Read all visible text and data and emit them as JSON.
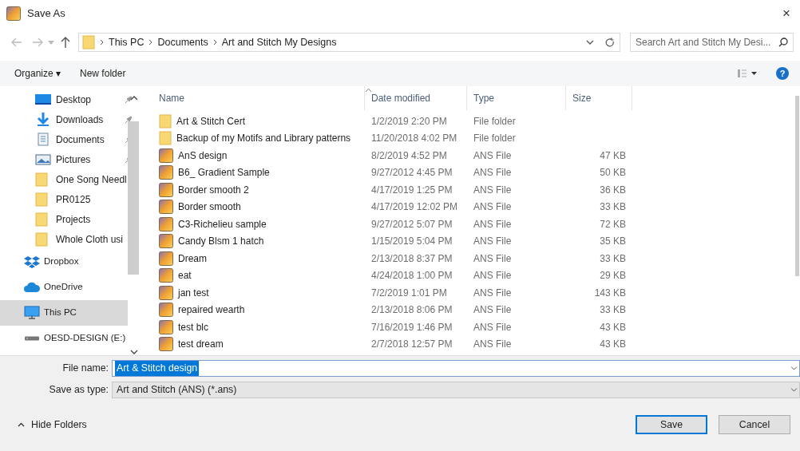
{
  "window": {
    "title": "Save As",
    "close": "×"
  },
  "address": {
    "path": [
      "This PC",
      "Documents",
      "Art and Stitch My Designs"
    ],
    "search_placeholder": "Search Art and Stitch My Desi..."
  },
  "toolbar": {
    "organize": "Organize ▾",
    "new_folder": "New folder",
    "help": "?"
  },
  "sidebar": {
    "quick_access_items": [
      {
        "kind": "desktop",
        "label": "Desktop",
        "pinned": true
      },
      {
        "kind": "downloads",
        "label": "Downloads",
        "pinned": true
      },
      {
        "kind": "documents",
        "label": "Documents",
        "pinned": true
      },
      {
        "kind": "pictures",
        "label": "Pictures",
        "pinned": true
      },
      {
        "kind": "folder",
        "label": "One Song Needl",
        "pinned": false
      },
      {
        "kind": "folder",
        "label": "PR0125",
        "pinned": false
      },
      {
        "kind": "folder",
        "label": "Projects",
        "pinned": false
      },
      {
        "kind": "folder",
        "label": "Whole Cloth usi",
        "pinned": false
      }
    ],
    "locations": [
      {
        "kind": "dropbox",
        "label": "Dropbox",
        "selected": false
      },
      {
        "kind": "onedrive",
        "label": "OneDrive",
        "selected": false
      },
      {
        "kind": "pc",
        "label": "This PC",
        "selected": true
      },
      {
        "kind": "drive",
        "label": "OESD-DESIGN (E:)",
        "selected": false
      }
    ]
  },
  "table": {
    "columns": [
      "Name",
      "Date modified",
      "Type",
      "Size"
    ],
    "rows": [
      {
        "kind": "folder",
        "name": "Art & Stitch Cert",
        "date": "1/2/2019 2:20 PM",
        "type": "File folder",
        "size": ""
      },
      {
        "kind": "folder",
        "name": "Backup of my Motifs and Library patterns",
        "date": "11/20/2018 4:02 PM",
        "type": "File folder",
        "size": ""
      },
      {
        "kind": "ans",
        "name": "AnS design",
        "date": "8/2/2019 4:52 PM",
        "type": "ANS File",
        "size": "47 KB"
      },
      {
        "kind": "ans",
        "name": "B6_ Gradient Sample",
        "date": "9/27/2012 4:45 PM",
        "type": "ANS File",
        "size": "50 KB"
      },
      {
        "kind": "ans",
        "name": "Border smooth 2",
        "date": "4/17/2019 1:25 PM",
        "type": "ANS File",
        "size": "36 KB"
      },
      {
        "kind": "ans",
        "name": "Border smooth",
        "date": "4/17/2019 12:02 PM",
        "type": "ANS File",
        "size": "33 KB"
      },
      {
        "kind": "ans",
        "name": "C3-Richelieu sample",
        "date": "9/27/2012 5:07 PM",
        "type": "ANS File",
        "size": "72 KB"
      },
      {
        "kind": "ans",
        "name": "Candy Blsm 1 hatch",
        "date": "1/15/2019 5:04 PM",
        "type": "ANS File",
        "size": "35 KB"
      },
      {
        "kind": "ans",
        "name": "Dream",
        "date": "2/13/2018 8:37 PM",
        "type": "ANS File",
        "size": "33 KB"
      },
      {
        "kind": "ans",
        "name": "eat",
        "date": "4/24/2018 1:00 PM",
        "type": "ANS File",
        "size": "29 KB"
      },
      {
        "kind": "ans",
        "name": "jan test",
        "date": "7/2/2019 1:01 PM",
        "type": "ANS File",
        "size": "143 KB"
      },
      {
        "kind": "ans",
        "name": "repaired wearth",
        "date": "2/13/2018 8:06 PM",
        "type": "ANS File",
        "size": "33 KB"
      },
      {
        "kind": "ans",
        "name": "test blc",
        "date": "7/16/2019 1:46 PM",
        "type": "ANS File",
        "size": "43 KB"
      },
      {
        "kind": "ans",
        "name": "test dream",
        "date": "2/7/2018 12:57 PM",
        "type": "ANS File",
        "size": "43 KB"
      }
    ]
  },
  "form": {
    "file_name_label": "File name:",
    "file_name": "Art & Stitch design",
    "save_type_label": "Save as type:",
    "save_type": "Art and Stitch (ANS) (*.ans)"
  },
  "footer": {
    "hide_folders": "Hide Folders",
    "save": "Save",
    "cancel": "Cancel"
  }
}
